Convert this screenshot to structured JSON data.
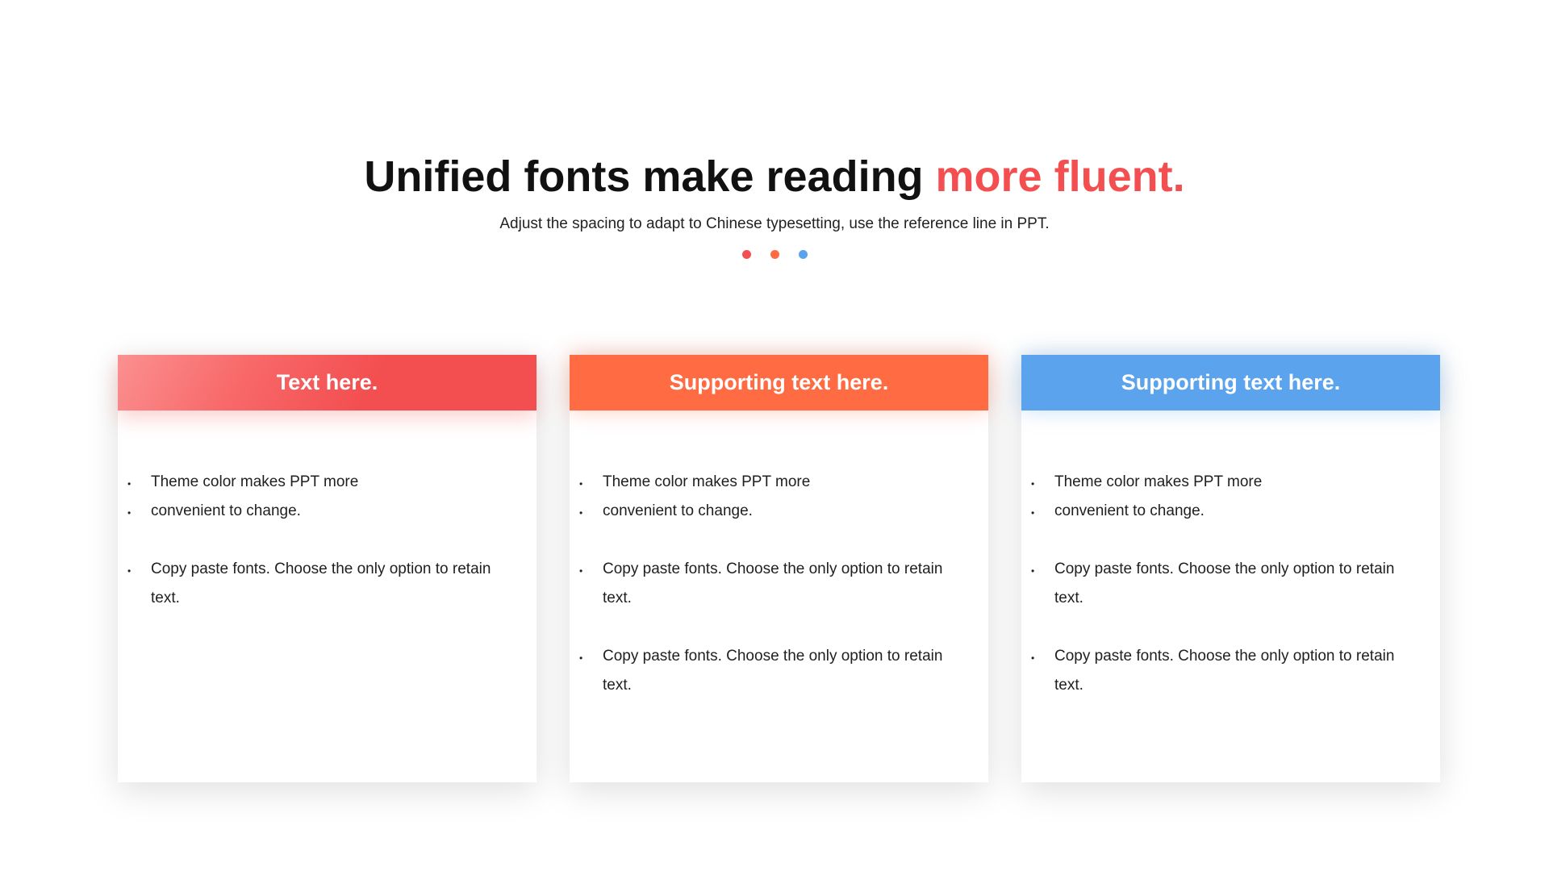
{
  "title": {
    "main": "Unified fonts make reading ",
    "accent": "more fluent.",
    "subtitle": "Adjust the spacing to adapt to Chinese typesetting, use the reference line in PPT."
  },
  "colors": {
    "red": "#f34f50",
    "orange": "#ff6b43",
    "blue": "#5ba3ec"
  },
  "cards": [
    {
      "header": "Text here.",
      "bullets": [
        "Theme color makes PPT more",
        "convenient to change.",
        "Copy paste  fonts. Choose the only option to retain text."
      ]
    },
    {
      "header": "Supporting text here.",
      "bullets": [
        "Theme color makes PPT more",
        "convenient to change.",
        "Copy paste  fonts. Choose the only option to retain text.",
        "Copy paste  fonts. Choose the only option to retain text."
      ]
    },
    {
      "header": "Supporting text here.",
      "bullets": [
        "Theme color makes PPT more",
        "convenient to change.",
        "Copy paste  fonts. Choose the only option to retain text.",
        "Copy paste  fonts. Choose the only option to retain text."
      ]
    }
  ]
}
